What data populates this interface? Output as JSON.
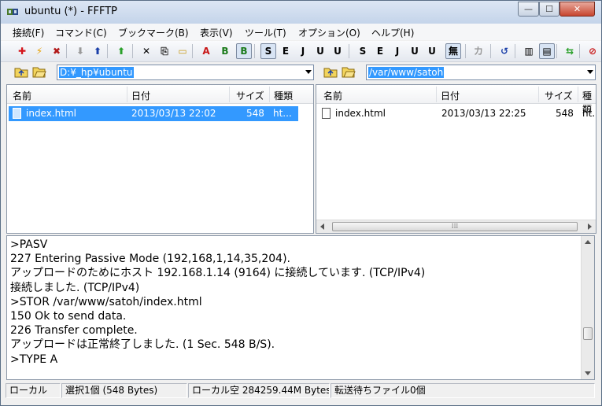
{
  "window": {
    "title": "ubuntu (*) - FFFTP",
    "controls": {
      "minimize": "—",
      "maximize": "☐",
      "close": "✕"
    }
  },
  "menu": [
    "接続(F)",
    "コマンド(C)",
    "ブックマーク(B)",
    "表示(V)",
    "ツール(T)",
    "オプション(O)",
    "ヘルプ(H)"
  ],
  "toolbar": {
    "buttons": [
      {
        "name": "connect-icon",
        "glyph": "✚",
        "color": "#d4141a"
      },
      {
        "name": "quick-connect-icon",
        "glyph": "⚡",
        "color": "#e8a000"
      },
      {
        "name": "disconnect-icon",
        "glyph": "✖",
        "color": "#b21a1a"
      },
      {
        "name": "download-icon",
        "glyph": "⬇",
        "color": "#9a9a9a"
      },
      {
        "name": "upload-icon",
        "glyph": "⬆",
        "color": "#1a3fa8"
      },
      {
        "name": "mirror-upload-icon",
        "glyph": "⬆",
        "color": "#2aa02a"
      },
      {
        "name": "delete-icon",
        "glyph": "✕",
        "color": "#000000"
      },
      {
        "name": "rename-icon",
        "glyph": "⎘",
        "color": "#333333"
      },
      {
        "name": "mkdir-icon",
        "glyph": "▭",
        "color": "#c89b1a"
      },
      {
        "name": "ascii-mode-icon",
        "glyph": "A",
        "color": "#c81818"
      },
      {
        "name": "binary-mode-icon",
        "glyph": "B",
        "color": "#1a7a1a"
      },
      {
        "name": "auto-mode-icon",
        "glyph": "B",
        "color": "#1a7a1a"
      },
      {
        "name": "sjis-icon",
        "glyph": "S",
        "color": "#000000"
      },
      {
        "name": "euc-icon",
        "glyph": "E",
        "color": "#000000"
      },
      {
        "name": "jis-icon",
        "glyph": "J",
        "color": "#000000"
      },
      {
        "name": "utf8n-icon",
        "glyph": "U",
        "color": "#000000"
      },
      {
        "name": "utf8-icon",
        "glyph": "U",
        "color": "#000000"
      },
      {
        "name": "local-sjis-icon",
        "glyph": "S",
        "color": "#000000"
      },
      {
        "name": "local-euc-icon",
        "glyph": "E",
        "color": "#000000"
      },
      {
        "name": "local-jis-icon",
        "glyph": "J",
        "color": "#000000"
      },
      {
        "name": "local-utf8n-icon",
        "glyph": "U",
        "color": "#000000"
      },
      {
        "name": "local-utf8-icon",
        "glyph": "U",
        "color": "#000000"
      },
      {
        "name": "no-conversion-icon",
        "glyph": "無",
        "color": "#000000"
      },
      {
        "name": "kana-convert-icon",
        "glyph": "カ",
        "color": "#999999"
      },
      {
        "name": "refresh-icon",
        "glyph": "↺",
        "color": "#1a3fa8"
      },
      {
        "name": "list-view-icon",
        "glyph": "▥",
        "color": "#000000"
      },
      {
        "name": "detail-view-icon",
        "glyph": "▤",
        "color": "#000000"
      },
      {
        "name": "sync-folder-icon",
        "glyph": "⇆",
        "color": "#2aa02a"
      },
      {
        "name": "stop-icon",
        "glyph": "⊘",
        "color": "#c81818"
      }
    ]
  },
  "local": {
    "path": "D:¥_hp¥ubuntu",
    "columns": [
      "名前",
      "日付",
      "サイズ",
      "種類"
    ],
    "files": [
      {
        "name": "index.html",
        "date": "2013/03/13 22:02",
        "size": "548",
        "type": "ht..."
      }
    ]
  },
  "remote": {
    "path": "/var/www/satoh",
    "columns": [
      "名前",
      "日付",
      "サイズ",
      "種類"
    ],
    "files": [
      {
        "name": "index.html",
        "date": "2013/03/13 22:25",
        "size": "548",
        "type": "ht."
      }
    ]
  },
  "log": [
    ">PASV",
    "227 Entering Passive Mode (192,168,1,14,35,204).",
    "アップロードのためにホスト 192.168.1.14 (9164) に接続しています. (TCP/IPv4)",
    "接続しました. (TCP/IPv4)",
    ">STOR /var/www/satoh/index.html",
    "150 Ok to send data.",
    "226 Transfer complete.",
    "アップロードは正常終了しました. (1 Sec. 548 B/S).",
    ">TYPE A"
  ],
  "status": {
    "mode": "ローカル",
    "selection": "選択1個 (548 Bytes)",
    "free": "ローカル空 284259.44M Bytes",
    "queue": "転送待ちファイル0個"
  }
}
